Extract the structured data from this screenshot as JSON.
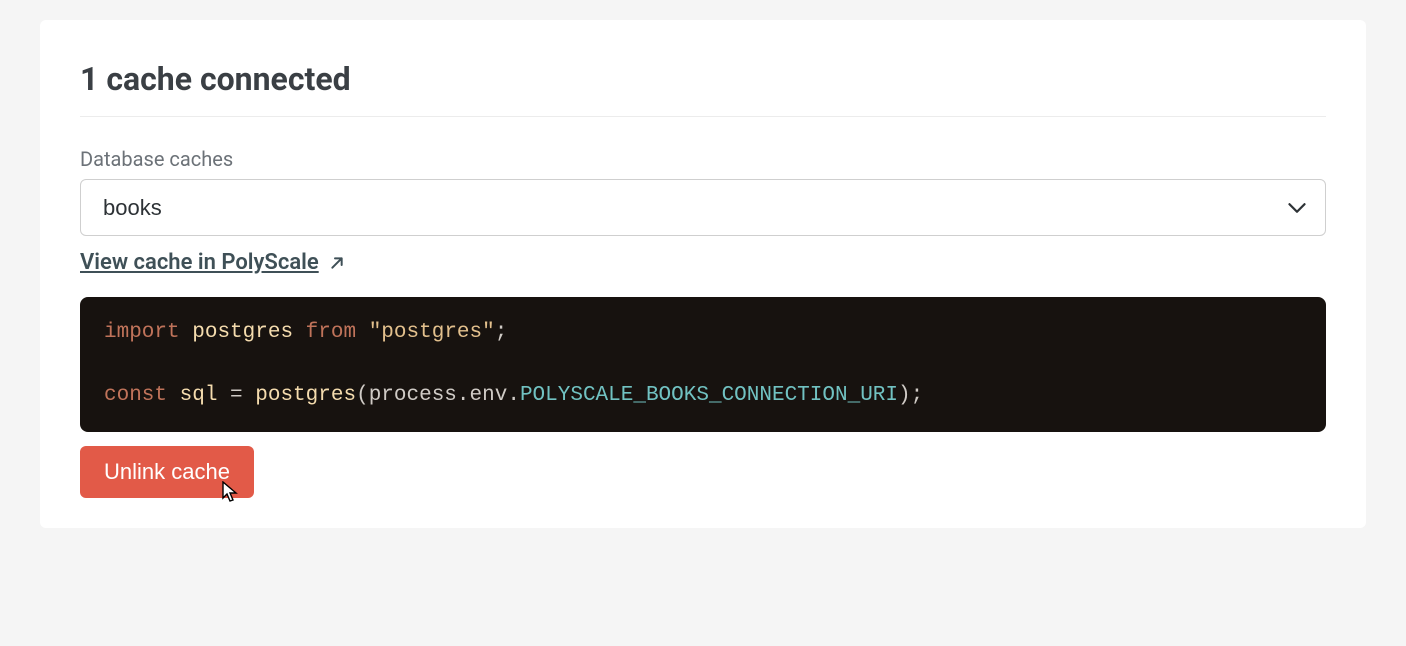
{
  "heading": "1 cache connected",
  "caches": {
    "label": "Database caches",
    "selected": "books"
  },
  "view_cache_link": "View cache in PolyScale",
  "code": {
    "line1": {
      "kw_import": "import",
      "ident_postgres": "postgres",
      "kw_from": "from",
      "str_postgres": "\"postgres\"",
      "semi": ";"
    },
    "line2": {
      "kw_const": "const",
      "ident_sql": "sql",
      "eq": " = ",
      "func_postgres": "postgres",
      "open": "(",
      "process": "process",
      "dot1": ".",
      "env": "env",
      "dot2": ".",
      "envvar": "POLYSCALE_BOOKS_CONNECTION_URI",
      "close": ");"
    }
  },
  "unlink_label": "Unlink cache"
}
